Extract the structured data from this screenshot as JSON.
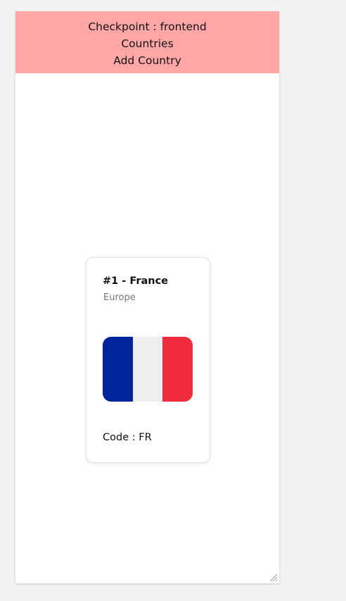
{
  "header": {
    "line1": "Checkpoint : frontend",
    "line2": "Countries",
    "add_link": "Add Country",
    "background": "#ffa6a6"
  },
  "card": {
    "title": "#1 - France",
    "region": "Europe",
    "code_text": "Code : FR",
    "flag": {
      "country": "France",
      "colors": [
        "#00249c",
        "#eeeeee",
        "#ef2b3d"
      ]
    }
  },
  "icons": {
    "resize": "resize-grip-icon"
  }
}
